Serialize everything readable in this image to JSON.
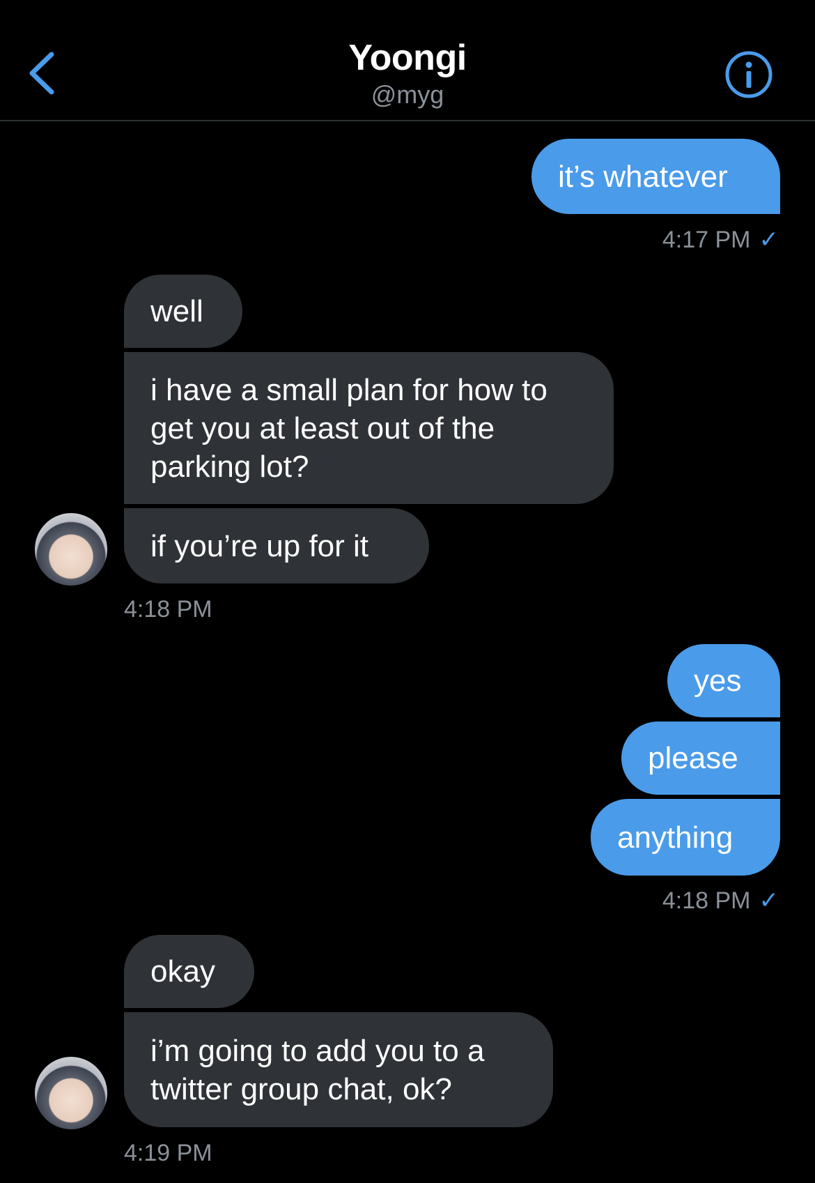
{
  "header": {
    "title": "Yoongi",
    "handle": "@myg",
    "back_icon": "chevron-left-icon",
    "info_icon": "info-circle-icon"
  },
  "colors": {
    "background": "#000000",
    "accent": "#4a9be9",
    "received_bubble": "#2f3237",
    "muted_text": "#8b9199"
  },
  "messages": [
    {
      "from": "me",
      "text": "it’s whatever"
    },
    {
      "from": "me_meta",
      "time": "4:17 PM",
      "check": "✓"
    },
    {
      "from": "them",
      "text": "well"
    },
    {
      "from": "them",
      "text": "i have a small plan for how to\nget you at least out of the\nparking lot?"
    },
    {
      "from": "them",
      "text": "if you’re up for it"
    },
    {
      "from": "them_meta",
      "time": "4:18 PM"
    },
    {
      "from": "me",
      "text": "yes"
    },
    {
      "from": "me",
      "text": "please"
    },
    {
      "from": "me",
      "text": "anything"
    },
    {
      "from": "me_meta",
      "time": "4:18 PM",
      "check": "✓"
    },
    {
      "from": "them",
      "text": "okay"
    },
    {
      "from": "them",
      "text": "i’m going to add you to a\ntwitter group chat, ok?"
    },
    {
      "from": "them_meta",
      "time": "4:19 PM"
    }
  ]
}
